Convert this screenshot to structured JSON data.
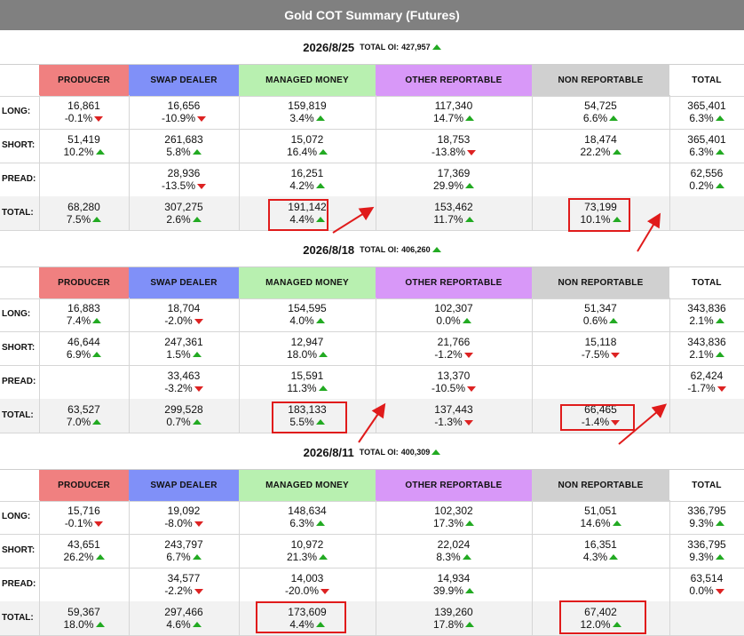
{
  "title": "Gold COT Summary (Futures)",
  "oi_label": "TOTAL OI:",
  "headers": {
    "producer": "PRODUCER",
    "swap": "SWAP DEALER",
    "managed": "MANAGED MONEY",
    "other": "OTHER REPORTABLE",
    "nonrep": "NON REPORTABLE",
    "total": "TOTAL"
  },
  "row_labels": {
    "long": "LONG:",
    "short": "SHORT:",
    "spread": "PREAD:",
    "total": "TOTAL:"
  },
  "colors": {
    "producer": "#f08080",
    "swap": "#8090f8",
    "managed": "#b8f0b0",
    "other": "#d898f8",
    "nonrep": "#d0d0d0",
    "up": "#22aa22",
    "down": "#dd2222",
    "highlight": "#e01b1b"
  },
  "icons": {
    "up": "triangle-up-icon",
    "down": "triangle-down-icon",
    "annotation": "red-arrow-icon"
  },
  "weeks": [
    {
      "date": "2026/8/25",
      "oi": "427,957",
      "oi_dir": "up",
      "rows": {
        "long": [
          [
            "16,861",
            "-0.1%",
            "down"
          ],
          [
            "16,656",
            "-10.9%",
            "down"
          ],
          [
            "159,819",
            "3.4%",
            "up"
          ],
          [
            "117,340",
            "14.7%",
            "up"
          ],
          [
            "54,725",
            "6.6%",
            "up"
          ],
          [
            "365,401",
            "6.3%",
            "up"
          ]
        ],
        "short": [
          [
            "51,419",
            "10.2%",
            "up"
          ],
          [
            "261,683",
            "5.8%",
            "up"
          ],
          [
            "15,072",
            "16.4%",
            "up"
          ],
          [
            "18,753",
            "-13.8%",
            "down"
          ],
          [
            "18,474",
            "22.2%",
            "up"
          ],
          [
            "365,401",
            "6.3%",
            "up"
          ]
        ],
        "spread": [
          null,
          [
            "28,936",
            "-13.5%",
            "down"
          ],
          [
            "16,251",
            "4.2%",
            "up"
          ],
          [
            "17,369",
            "29.9%",
            "up"
          ],
          null,
          [
            "62,556",
            "0.2%",
            "up"
          ]
        ],
        "total": [
          [
            "68,280",
            "7.5%",
            "up"
          ],
          [
            "307,275",
            "2.6%",
            "up"
          ],
          [
            "191,142",
            "4.4%",
            "up"
          ],
          [
            "153,462",
            "11.7%",
            "up"
          ],
          [
            "73,199",
            "10.1%",
            "up"
          ],
          null
        ]
      }
    },
    {
      "date": "2026/8/18",
      "oi": "406,260",
      "oi_dir": "up",
      "rows": {
        "long": [
          [
            "16,883",
            "7.4%",
            "up"
          ],
          [
            "18,704",
            "-2.0%",
            "down"
          ],
          [
            "154,595",
            "4.0%",
            "up"
          ],
          [
            "102,307",
            "0.0%",
            "up"
          ],
          [
            "51,347",
            "0.6%",
            "up"
          ],
          [
            "343,836",
            "2.1%",
            "up"
          ]
        ],
        "short": [
          [
            "46,644",
            "6.9%",
            "up"
          ],
          [
            "247,361",
            "1.5%",
            "up"
          ],
          [
            "12,947",
            "18.0%",
            "up"
          ],
          [
            "21,766",
            "-1.2%",
            "down"
          ],
          [
            "15,118",
            "-7.5%",
            "down"
          ],
          [
            "343,836",
            "2.1%",
            "up"
          ]
        ],
        "spread": [
          null,
          [
            "33,463",
            "-3.2%",
            "down"
          ],
          [
            "15,591",
            "11.3%",
            "up"
          ],
          [
            "13,370",
            "-10.5%",
            "down"
          ],
          null,
          [
            "62,424",
            "-1.7%",
            "down"
          ]
        ],
        "total": [
          [
            "63,527",
            "7.0%",
            "up"
          ],
          [
            "299,528",
            "0.7%",
            "up"
          ],
          [
            "183,133",
            "5.5%",
            "up"
          ],
          [
            "137,443",
            "-1.3%",
            "down"
          ],
          [
            "66,465",
            "-1.4%",
            "down"
          ],
          null
        ]
      }
    },
    {
      "date": "2026/8/11",
      "oi": "400,309",
      "oi_dir": "up",
      "rows": {
        "long": [
          [
            "15,716",
            "-0.1%",
            "down"
          ],
          [
            "19,092",
            "-8.0%",
            "down"
          ],
          [
            "148,634",
            "6.3%",
            "up"
          ],
          [
            "102,302",
            "17.3%",
            "up"
          ],
          [
            "51,051",
            "14.6%",
            "up"
          ],
          [
            "336,795",
            "9.3%",
            "up"
          ]
        ],
        "short": [
          [
            "43,651",
            "26.2%",
            "up"
          ],
          [
            "243,797",
            "6.7%",
            "up"
          ],
          [
            "10,972",
            "21.3%",
            "up"
          ],
          [
            "22,024",
            "8.3%",
            "up"
          ],
          [
            "16,351",
            "4.3%",
            "up"
          ],
          [
            "336,795",
            "9.3%",
            "up"
          ]
        ],
        "spread": [
          null,
          [
            "34,577",
            "-2.2%",
            "down"
          ],
          [
            "14,003",
            "-20.0%",
            "down"
          ],
          [
            "14,934",
            "39.9%",
            "up"
          ],
          null,
          [
            "63,514",
            "0.0%",
            "down"
          ]
        ],
        "total": [
          [
            "59,367",
            "18.0%",
            "up"
          ],
          [
            "297,466",
            "4.6%",
            "up"
          ],
          [
            "173,609",
            "4.4%",
            "up"
          ],
          [
            "139,260",
            "17.8%",
            "up"
          ],
          [
            "67,402",
            "12.0%",
            "up"
          ],
          null
        ]
      }
    }
  ]
}
